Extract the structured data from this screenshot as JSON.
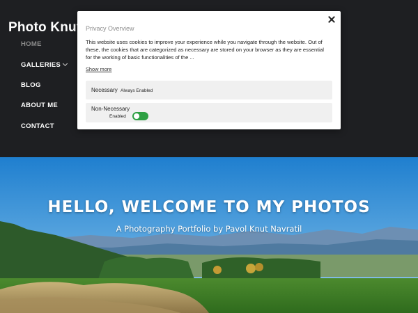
{
  "site": {
    "title": "Photo Knut",
    "nav": [
      {
        "label": "HOME",
        "active": true
      },
      {
        "label": "GALLERIES",
        "has_dropdown": true,
        "icon": "chevron-down-icon"
      },
      {
        "label": "BLOG"
      },
      {
        "label": "ABOUT ME"
      },
      {
        "label": "CONTACT"
      }
    ]
  },
  "hero": {
    "title": "HELLO, WELCOME TO MY PHOTOS",
    "subtitle": "A Photography Portfolio by Pavol Knut Navratil"
  },
  "cookie_modal": {
    "title": "Privacy Overview",
    "body": "This website uses cookies to improve your experience while you navigate through the website. Out of these, the cookies that are categorized as necessary are stored on your browser as they are essential for the working of basic functionalities of the ...",
    "show_more": "Show more",
    "close_icon": "close-icon",
    "categories": [
      {
        "name": "Necessary",
        "status": "Always Enabled"
      },
      {
        "name": "Non-Necessary",
        "status": "Enabled",
        "toggle_on": true
      }
    ]
  },
  "colors": {
    "header_bg": "#1e1f22",
    "toggle_on": "#2ea043",
    "nav_active": "#8c8c8c",
    "category_bg": "#f0f0f0"
  }
}
